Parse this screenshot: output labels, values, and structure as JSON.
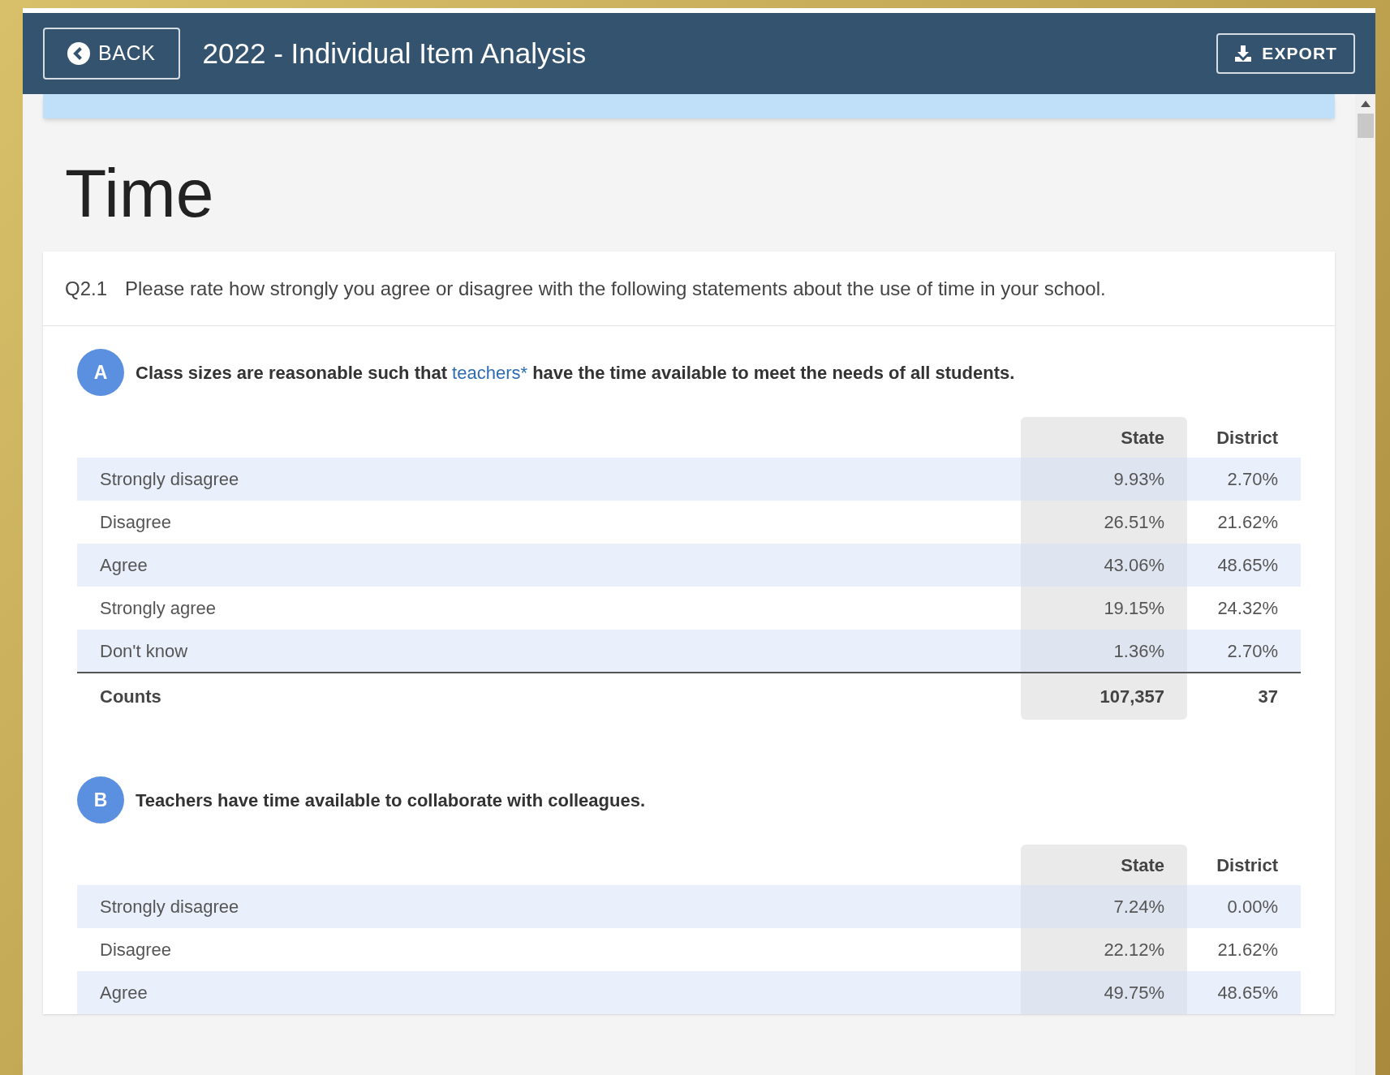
{
  "header": {
    "back_button": "BACK",
    "title": "2022 - Individual Item Analysis",
    "export_button": "EXPORT"
  },
  "section_title": "Time",
  "question": {
    "number": "Q2.1",
    "text": "Please rate how strongly you agree or disagree with the following statements about the use of time in your school."
  },
  "items": [
    {
      "letter": "A",
      "statement": [
        {
          "kind": "text",
          "text": "Class sizes are reasonable such that "
        },
        {
          "kind": "link",
          "text": "teachers*"
        },
        {
          "kind": "text",
          "text": " have the time available to meet the needs of all students."
        }
      ],
      "columns": [
        "State",
        "District"
      ],
      "rows": [
        {
          "label": "Strongly disagree",
          "values": [
            "9.93%",
            "2.70%"
          ]
        },
        {
          "label": "Disagree",
          "values": [
            "26.51%",
            "21.62%"
          ]
        },
        {
          "label": "Agree",
          "values": [
            "43.06%",
            "48.65%"
          ]
        },
        {
          "label": "Strongly agree",
          "values": [
            "19.15%",
            "24.32%"
          ]
        },
        {
          "label": "Don't know",
          "values": [
            "1.36%",
            "2.70%"
          ]
        }
      ],
      "counts": {
        "label": "Counts",
        "values": [
          "107,357",
          "37"
        ]
      }
    },
    {
      "letter": "B",
      "statement": [
        {
          "kind": "text",
          "text": "Teachers have time available to collaborate with colleagues."
        }
      ],
      "columns": [
        "State",
        "District"
      ],
      "rows": [
        {
          "label": "Strongly disagree",
          "values": [
            "7.24%",
            "0.00%"
          ]
        },
        {
          "label": "Disagree",
          "values": [
            "22.12%",
            "21.62%"
          ]
        },
        {
          "label": "Agree",
          "values": [
            "49.75%",
            "48.65%"
          ]
        }
      ]
    }
  ]
}
